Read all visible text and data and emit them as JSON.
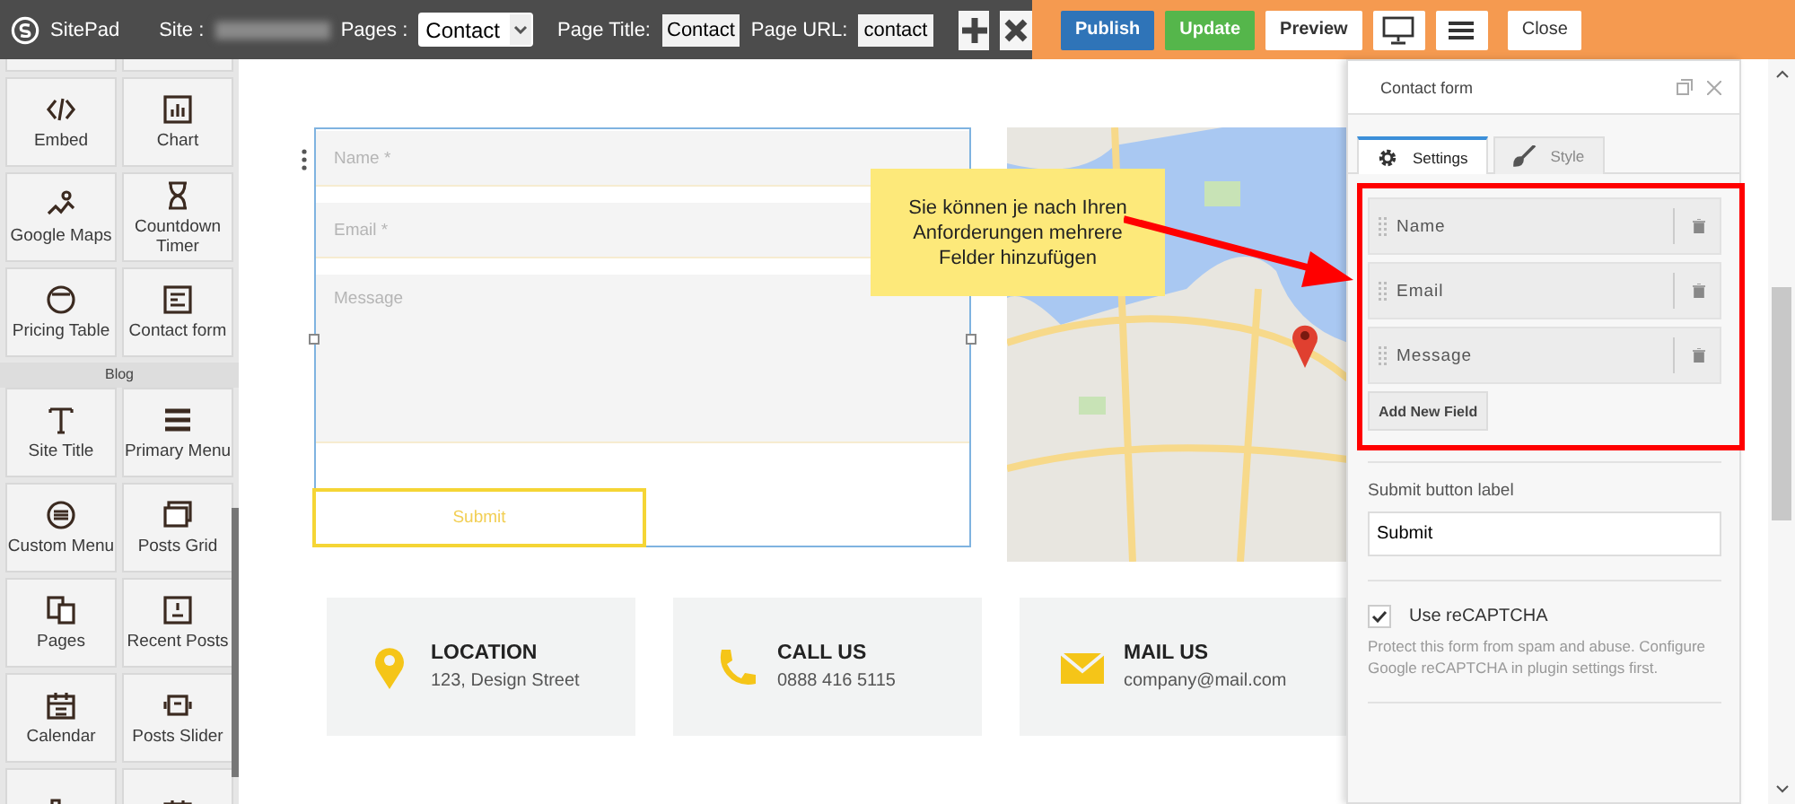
{
  "topbar": {
    "logo": "SitePad",
    "site_label": "Site :",
    "pages_label": "Pages :",
    "pages_value": "Contact",
    "page_title_label": "Page Title:",
    "page_title": "Contact",
    "page_url_label": "Page URL:",
    "page_url": "contact",
    "actions": [
      {
        "label": "Publish",
        "kind": "primary"
      },
      {
        "label": "Update",
        "kind": "success"
      },
      {
        "label": "Preview",
        "kind": "plain"
      }
    ],
    "close": "Close"
  },
  "sidebar": {
    "groups": [
      {
        "items": [
          {
            "label": "Embed"
          },
          {
            "label": "Chart"
          },
          {
            "label": "Google Maps"
          },
          {
            "label": "Countdown Timer"
          },
          {
            "label": "Pricing Table"
          },
          {
            "label": "Contact form"
          }
        ]
      },
      {
        "title": "Blog",
        "items": [
          {
            "label": "Site Title"
          },
          {
            "label": "Primary Menu"
          },
          {
            "label": "Custom Menu"
          },
          {
            "label": "Posts Grid"
          },
          {
            "label": "Pages"
          },
          {
            "label": "Recent Posts"
          },
          {
            "label": "Calendar"
          },
          {
            "label": "Posts Slider"
          }
        ]
      }
    ]
  },
  "form": {
    "fields": [
      {
        "placeholder": "Name *",
        "kind": "input"
      },
      {
        "placeholder": "Email *",
        "kind": "input"
      },
      {
        "placeholder": "Message",
        "kind": "textarea"
      }
    ],
    "submit": "Submit"
  },
  "cards": [
    {
      "title": "LOCATION",
      "text": "123, Design Street",
      "kind": "location"
    },
    {
      "title": "CALL US",
      "text": "0888 416 5115",
      "kind": "phone"
    },
    {
      "title": "MAIL US",
      "text": "company@mail.com",
      "kind": "mail"
    }
  ],
  "callout": "Sie können je nach Ihren Anforderungen mehrere Felder hinzufügen",
  "panel": {
    "title": "Contact form",
    "tabs": [
      {
        "label": "Settings",
        "selected": true
      },
      {
        "label": "Style",
        "selected": false
      }
    ],
    "fields": [
      "Name",
      "Email",
      "Message"
    ],
    "add_button": "Add New Field",
    "submit_label": "Submit button label",
    "submit_value": "Submit",
    "recaptcha": {
      "label": "Use reCAPTCHA",
      "checked": true,
      "help": "Protect this form from spam and abuse. Configure Google reCAPTCHA in plugin settings first."
    }
  }
}
